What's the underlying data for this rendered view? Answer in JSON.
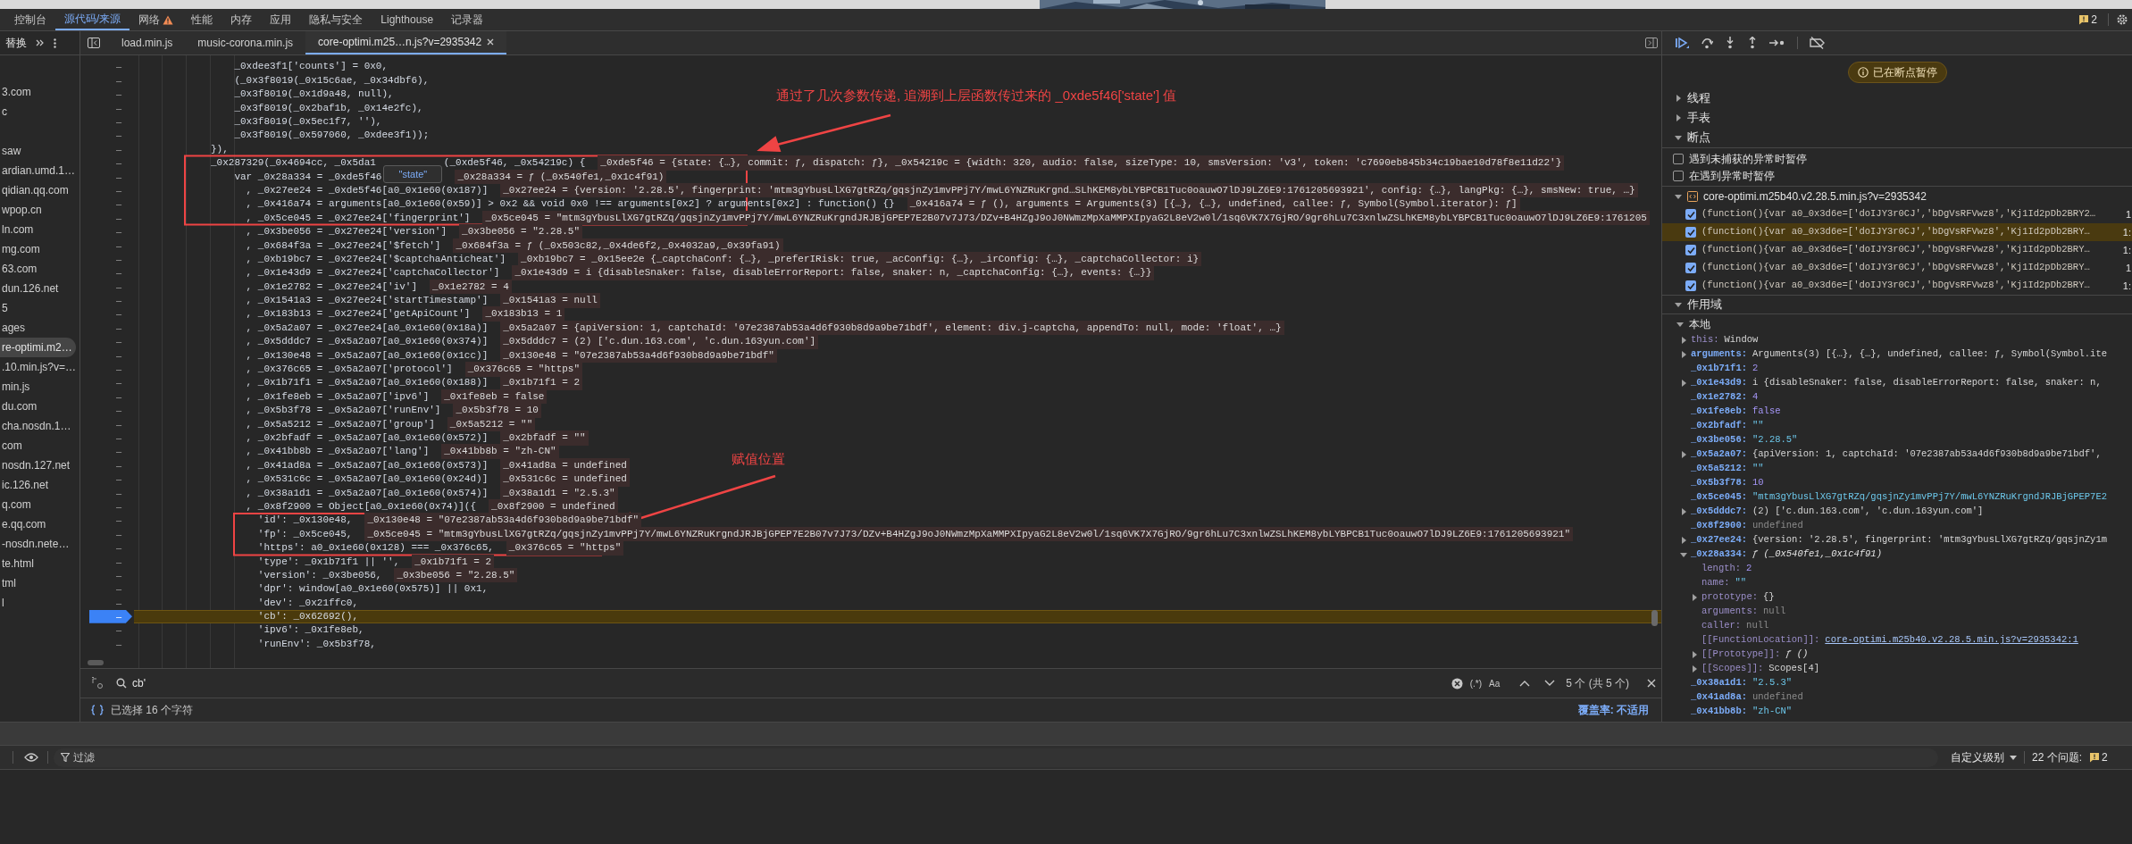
{
  "main_tabs": [
    {
      "label": "控制台",
      "selected": false,
      "warning": false
    },
    {
      "label": "源代码/来源",
      "selected": true,
      "warning": false
    },
    {
      "label": "网络",
      "selected": false,
      "warning": true
    },
    {
      "label": "性能",
      "selected": false,
      "warning": false
    },
    {
      "label": "内存",
      "selected": false,
      "warning": false
    },
    {
      "label": "应用",
      "selected": false,
      "warning": false
    },
    {
      "label": "隐私与安全",
      "selected": false,
      "warning": false
    },
    {
      "label": "Lighthouse",
      "selected": false,
      "warning": false
    },
    {
      "label": "记录器",
      "selected": false,
      "warning": false
    }
  ],
  "issue_badge": "2",
  "sidebar": {
    "title": "替换",
    "groups": [
      [
        {
          "label": "3.com",
          "selected": false
        },
        {
          "label": "c",
          "selected": false
        }
      ],
      [
        {
          "label": "saw",
          "selected": false
        },
        {
          "label": "ardian.umd.1…",
          "selected": false
        },
        {
          "label": "qidian.qq.com",
          "selected": false
        },
        {
          "label": "wpop.cn",
          "selected": false
        },
        {
          "label": "ln.com",
          "selected": false
        },
        {
          "label": "mg.com",
          "selected": false
        },
        {
          "label": "63.com",
          "selected": false
        },
        {
          "label": "dun.126.net",
          "selected": false
        },
        {
          "label": "5",
          "selected": false
        },
        {
          "label": "ages",
          "selected": false
        },
        {
          "label": "re-optimi.m2…",
          "selected": true
        },
        {
          "label": ".10.min.js?v=…",
          "selected": false
        },
        {
          "label": "min.js",
          "selected": false
        },
        {
          "label": "du.com",
          "selected": false
        },
        {
          "label": "cha.nosdn.1…",
          "selected": false
        },
        {
          "label": "com",
          "selected": false
        },
        {
          "label": "nosdn.127.net",
          "selected": false
        },
        {
          "label": "ic.126.net",
          "selected": false
        },
        {
          "label": "q.com",
          "selected": false
        },
        {
          "label": "e.qq.com",
          "selected": false
        },
        {
          "label": "-nosdn.nete…",
          "selected": false
        },
        {
          "label": "te.html",
          "selected": false
        },
        {
          "label": "tml",
          "selected": false
        },
        {
          "label": "l",
          "selected": false
        }
      ]
    ]
  },
  "file_tabs": [
    {
      "label": "load.min.js",
      "selected": false
    },
    {
      "label": "music-corona.min.js",
      "selected": false
    },
    {
      "label": "core-optimi.m25…n.js?v=2935342",
      "selected": true
    }
  ],
  "code_lines": [
    {
      "gutter": "–",
      "code": "    _0xdee3f1['counts'] = 0x0,",
      "paused": false
    },
    {
      "gutter": "–",
      "code": "    (_0x3f8019(_0x15c6ae, _0x34dbf6),",
      "paused": false
    },
    {
      "gutter": "–",
      "code": "    _0x3f8019(_0x1d9a48, null),",
      "paused": false
    },
    {
      "gutter": "–",
      "code": "    _0x3f8019(_0x2baf1b, _0x14e2fc),",
      "paused": false
    },
    {
      "gutter": "–",
      "code": "    _0x3f8019(_0x5ec1f7, ''),",
      "paused": false
    },
    {
      "gutter": "–",
      "code": "    _0x3f8019(_0x597060, _0xdee3f1));",
      "paused": false
    },
    {
      "gutter": "–",
      "code": "}),",
      "paused": false
    },
    {
      "gutter": "–",
      "code": "_0x287329(_0x4694cc, _0x5da1",
      "code_after": "(_0xde5f46, _0x54219c) {",
      "value": "_0xde5f46 = {state: {…}, commit: ƒ, dispatch: ƒ}, _0x54219c = {width: 320, audio: false, sizeType: 10, smsVersion: 'v3', token: 'c7690eb845b34c19bae10d78f8e11d22'}",
      "paused": false
    },
    {
      "gutter": "–",
      "code": "    var _0x28a334 = _0xde5f46",
      "tooltip": "\"state\"",
      "value": "_0x28a334 = ƒ (_0x540fe1,_0x1c4f91)",
      "paused": false
    },
    {
      "gutter": "–",
      "code": "      , _0x27ee24 = _0xde5f46[a0_0x1e60(0x187)]",
      "value": "_0x27ee24 = {version: '2.28.5', fingerprint: 'mtm3gYbusLlXG7gtRZq/gqsjnZy1mvPPj7Y/mwL6YNZRuKrgnd…SLhKEM8ybLYBPCB1Tuc0oauwO7lDJ9LZ6E9:1761205693921', config: {…}, langPkg: {…}, smsNew: true, …}",
      "paused": false
    },
    {
      "gutter": "–",
      "code": "      , _0x416a74 = arguments[a0_0x1e60(0x59)] > 0x2 && void 0x0 !== arguments[0x2] ? arguments[0x2] : function() {}",
      "value": "_0x416a74 = ƒ (), arguments = Arguments(3) [{…}, {…}, undefined, callee: ƒ, Symbol(Symbol.iterator): ƒ]",
      "paused": false
    },
    {
      "gutter": "–",
      "code": "      , _0x5ce045 = _0x27ee24['fingerprint']",
      "value": "_0x5ce045 = \"mtm3gYbusLlXG7gtRZq/gqsjnZy1mvPPj7Y/mwL6YNZRuKrgndJRJBjGPEP7E2B07v7J73/DZv+B4HZgJ9oJ0NWmzMpXaMMPXIpyaG2L8eV2w0l/1sq6VK7X7GjRO/9gr6hLu7C3xnlwZSLhKEM8ybLYBPCB1Tuc0oauwO7lDJ9LZ6E9:1761205",
      "paused": false
    },
    {
      "gutter": "–",
      "code": "      , _0x3be056 = _0x27ee24['version']",
      "value": "_0x3be056 = \"2.28.5\"",
      "paused": false
    },
    {
      "gutter": "–",
      "code": "      , _0x684f3a = _0x27ee24['$fetch']",
      "value": "_0x684f3a = ƒ (_0x503c82,_0x4de6f2,_0x4032a9,_0x39fa91)",
      "paused": false
    },
    {
      "gutter": "–",
      "code": "      , _0xb19bc7 = _0x27ee24['$captchaAnticheat']",
      "value": "_0xb19bc7 = _0x15ee2e {_captchaConf: {…}, _preferIRisk: true, _acConfig: {…}, _irConfig: {…}, _captchaCollector: i}",
      "paused": false
    },
    {
      "gutter": "–",
      "code": "      , _0x1e43d9 = _0x27ee24['captchaCollector']",
      "value": "_0x1e43d9 = i {disableSnaker: false, disableErrorReport: false, snaker: n, _captchaConfig: {…}, events: {…}}",
      "paused": false
    },
    {
      "gutter": "–",
      "code": "      , _0x1e2782 = _0x27ee24['iv']",
      "value": "_0x1e2782 = 4",
      "paused": false
    },
    {
      "gutter": "–",
      "code": "      , _0x1541a3 = _0x27ee24['startTimestamp']",
      "value": "_0x1541a3 = null",
      "paused": false
    },
    {
      "gutter": "–",
      "code": "      , _0x183b13 = _0x27ee24['getApiCount']",
      "value": "_0x183b13 = 1",
      "paused": false
    },
    {
      "gutter": "–",
      "code": "      , _0x5a2a07 = _0x27ee24[a0_0x1e60(0x18a)]",
      "value": "_0x5a2a07 = {apiVersion: 1, captchaId: '07e2387ab53a4d6f930b8d9a9be71bdf', element: div.j-captcha, appendTo: null, mode: 'float', …}",
      "paused": false
    },
    {
      "gutter": "–",
      "code": "      , _0x5dddc7 = _0x5a2a07[a0_0x1e60(0x374)]",
      "value": "_0x5dddc7 = (2) ['c.dun.163.com', 'c.dun.163yun.com']",
      "paused": false
    },
    {
      "gutter": "–",
      "code": "      , _0x130e48 = _0x5a2a07[a0_0x1e60(0x1cc)]",
      "value": "_0x130e48 = \"07e2387ab53a4d6f930b8d9a9be71bdf\"",
      "paused": false
    },
    {
      "gutter": "–",
      "code": "      , _0x376c65 = _0x5a2a07['protocol']",
      "value": "_0x376c65 = \"https\"",
      "paused": false
    },
    {
      "gutter": "–",
      "code": "      , _0x1b71f1 = _0x5a2a07[a0_0x1e60(0x188)]",
      "value": "_0x1b71f1 = 2",
      "paused": false
    },
    {
      "gutter": "–",
      "code": "      , _0x1fe8eb = _0x5a2a07['ipv6']",
      "value": "_0x1fe8eb = false",
      "paused": false
    },
    {
      "gutter": "–",
      "code": "      , _0x5b3f78 = _0x5a2a07['runEnv']",
      "value": "_0x5b3f78 = 10",
      "paused": false
    },
    {
      "gutter": "–",
      "code": "      , _0x5a5212 = _0x5a2a07['group']",
      "value": "_0x5a5212 = \"\"",
      "paused": false
    },
    {
      "gutter": "–",
      "code": "      , _0x2bfadf = _0x5a2a07[a0_0x1e60(0x572)]",
      "value": "_0x2bfadf = \"\"",
      "paused": false
    },
    {
      "gutter": "–",
      "code": "      , _0x41bb8b = _0x5a2a07['lang']",
      "value": "_0x41bb8b = \"zh-CN\"",
      "paused": false
    },
    {
      "gutter": "–",
      "code": "      , _0x41ad8a = _0x5a2a07[a0_0x1e60(0x573)]",
      "value": "_0x41ad8a = undefined",
      "paused": false
    },
    {
      "gutter": "–",
      "code": "      , _0x531c6c = _0x5a2a07[a0_0x1e60(0x24d)]",
      "value": "_0x531c6c = undefined",
      "paused": false
    },
    {
      "gutter": "–",
      "code": "      , _0x38a1d1 = _0x5a2a07[a0_0x1e60(0x574)]",
      "value": "_0x38a1d1 = \"2.5.3\"",
      "paused": false
    },
    {
      "gutter": "–",
      "code": "      , _0x8f2900 = Object[a0_0x1e60(0x74)]({",
      "value": "_0x8f2900 = undefined",
      "paused": false
    },
    {
      "gutter": "–",
      "code": "        'id': _0x130e48,",
      "value": "_0x130e48 = \"07e2387ab53a4d6f930b8d9a9be71bdf\"",
      "paused": false
    },
    {
      "gutter": "–",
      "code": "        'fp': _0x5ce045,",
      "value": "_0x5ce045 = \"mtm3gYbusLlXG7gtRZq/gqsjnZy1mvPPj7Y/mwL6YNZRuKrgndJRJBjGPEP7E2B07v7J73/DZv+B4HZgJ9oJ0NWmzMpXaMMPXIpyaG2L8eV2w0l/1sq6VK7X7GjRO/9gr6hLu7C3xnlwZSLhKEM8ybLYBPCB1Tuc0oauwO7lDJ9LZ6E9:1761205693921\"",
      "paused": false
    },
    {
      "gutter": "–",
      "code": "        'https': a0_0x1e60(0x128) === _0x376c65,",
      "value": "_0x376c65 = \"https\"",
      "paused": false
    },
    {
      "gutter": "–",
      "code": "        'type': _0x1b71f1 || '',",
      "value": "_0x1b71f1 = 2",
      "paused": false
    },
    {
      "gutter": "–",
      "code": "        'version': _0x3be056,",
      "value": "_0x3be056 = \"2.28.5\"",
      "paused": false
    },
    {
      "gutter": "–",
      "code": "        'dpr': window[a0_0x1e60(0x575)] || 0x1,",
      "paused": false
    },
    {
      "gutter": "–",
      "code": "        'dev': _0x21ffc0,",
      "paused": false
    },
    {
      "gutter": "–",
      "code": "        'cb': _0x62692(),",
      "paused": true
    },
    {
      "gutter": "–",
      "code": "        'ipv6': _0x1fe8eb,",
      "paused": false
    },
    {
      "gutter": "–",
      "code": "        'runEnv': _0x5b3f78,",
      "paused": false
    }
  ],
  "annotations": [
    {
      "text": "通过了几次参数传递, 追溯到上层函数传过来的 _0xde5f46['state'] 值",
      "kind": "note"
    },
    {
      "text": "赋值位置",
      "kind": "label"
    }
  ],
  "search": {
    "value": "cb'",
    "regex": "(.*)",
    "match_case": "Aa",
    "match_count": "5 个 (共 5 个)"
  },
  "status": {
    "selection": "已选择 16 个字符",
    "coverage": "覆盖率: 不适用"
  },
  "debugger": {
    "paused_message": "已在断点暂停",
    "panes": [
      {
        "title": "线程",
        "expanded": false
      },
      {
        "title": "手表",
        "expanded": false
      },
      {
        "title": "断点",
        "expanded": true
      }
    ],
    "exception_options": [
      {
        "label": "遇到未捕获的异常时暂停",
        "checked": false
      },
      {
        "label": "在遇到异常时暂停",
        "checked": false
      }
    ],
    "breakpoint_file": {
      "name": "core-optimi.m25b40.v2.28.5.min.js?v=2935342",
      "expanded": true
    },
    "breakpoints": [
      {
        "code": "(function(){var a0_0x3d6e=['doIJY3r0CJ','bDgVsRFVwz8','Kj1Id2pDb2BRY2…",
        "line": "1",
        "checked": true,
        "selected": false
      },
      {
        "code": "(function(){var a0_0x3d6e=['doIJY3r0CJ','bDgVsRFVwz8','Kj1Id2pDb2BRY…",
        "line": "1:",
        "checked": true,
        "selected": true
      },
      {
        "code": "(function(){var a0_0x3d6e=['doIJY3r0CJ','bDgVsRFVwz8','Kj1Id2pDb2BRY…",
        "line": "1:",
        "checked": true,
        "selected": false
      },
      {
        "code": "(function(){var a0_0x3d6e=['doIJY3r0CJ','bDgVsRFVwz8','Kj1Id2pDb2BRY…",
        "line": "1",
        "checked": true,
        "selected": false
      },
      {
        "code": "(function(){var a0_0x3d6e=['doIJY3r0CJ','bDgVsRFVwz8','Kj1Id2pDb2BRY…",
        "line": "1:",
        "checked": true,
        "selected": false
      }
    ],
    "scope": {
      "title": "作用域",
      "expanded": true,
      "local": {
        "title": "本地",
        "expanded": true,
        "variables": [
          {
            "key": "this:",
            "value": "Window",
            "kind": "object",
            "expanded": false,
            "dim": true
          },
          {
            "key": "arguments:",
            "value": "Arguments(3) [{…}, {…}, undefined, callee: ƒ, Symbol(Symbol.ite",
            "kind": "object",
            "expanded": false,
            "dim": false
          },
          {
            "key": "_0x1b71f1:",
            "value": "2",
            "kind": "number",
            "dim": false
          },
          {
            "key": "_0x1e43d9:",
            "value": "i {disableSnaker: false, disableErrorReport: false, snaker: n,",
            "kind": "object",
            "expanded": false,
            "dim": false
          },
          {
            "key": "_0x1e2782:",
            "value": "4",
            "kind": "number",
            "dim": false
          },
          {
            "key": "_0x1fe8eb:",
            "value": "false",
            "kind": "number",
            "dim": false
          },
          {
            "key": "_0x2bfadf:",
            "value": "\"\"",
            "kind": "string",
            "dim": false
          },
          {
            "key": "_0x3be056:",
            "value": "\"2.28.5\"",
            "kind": "string",
            "dim": false
          },
          {
            "key": "_0x5a2a07:",
            "value": "{apiVersion: 1, captchaId: '07e2387ab53a4d6f930b8d9a9be71bdf',",
            "kind": "object",
            "expanded": false,
            "dim": false
          },
          {
            "key": "_0x5a5212:",
            "value": "\"\"",
            "kind": "string",
            "dim": false
          },
          {
            "key": "_0x5b3f78:",
            "value": "10",
            "kind": "number",
            "dim": false
          },
          {
            "key": "_0x5ce045:",
            "value": "\"mtm3gYbusLlXG7gtRZq/gqsjnZy1mvPPj7Y/mwL6YNZRuKrgndJRJBjGPEP7E2",
            "kind": "string",
            "dim": false
          },
          {
            "key": "_0x5dddc7:",
            "value": "(2) ['c.dun.163.com', 'c.dun.163yun.com']",
            "kind": "object",
            "expanded": false,
            "dim": false
          },
          {
            "key": "_0x8f2900:",
            "value": "undefined",
            "kind": "empty",
            "dim": false
          },
          {
            "key": "_0x27ee24:",
            "value": "{version: '2.28.5', fingerprint: 'mtm3gYbusLlXG7gtRZq/gqsjnZy1m",
            "kind": "object",
            "expanded": false,
            "dim": false
          },
          {
            "key": "_0x28a334:",
            "value": "ƒ (_0x540fe1,_0x1c4f91)",
            "kind": "function",
            "expanded": true,
            "dim": false,
            "children": [
              {
                "key": "length:",
                "value": "2",
                "kind": "number",
                "dim": true
              },
              {
                "key": "name:",
                "value": "\"\"",
                "kind": "string",
                "dim": true
              },
              {
                "key": "prototype:",
                "value": "{}",
                "kind": "object",
                "expanded": false,
                "dim": true
              },
              {
                "key": "arguments:",
                "value": "null",
                "kind": "empty",
                "dim": true
              },
              {
                "key": "caller:",
                "value": "null",
                "kind": "empty",
                "dim": true
              },
              {
                "key": "[[FunctionLocation]]:",
                "value": "core-optimi.m25b40.v2.28.5.min.js?v=2935342:1",
                "kind": "link",
                "dim": true
              },
              {
                "key": "[[Prototype]]:",
                "value": "ƒ ()",
                "kind": "function",
                "expanded": false,
                "dim": true
              },
              {
                "key": "[[Scopes]]:",
                "value": "Scopes[4]",
                "kind": "object",
                "expanded": false,
                "dim": true
              }
            ]
          },
          {
            "key": "_0x38a1d1:",
            "value": "\"2.5.3\"",
            "kind": "string",
            "dim": false
          },
          {
            "key": "_0x41ad8a:",
            "value": "undefined",
            "kind": "empty",
            "dim": false
          },
          {
            "key": "_0x41bb8b:",
            "value": "\"zh-CN\"",
            "kind": "string",
            "dim": false
          }
        ]
      }
    }
  },
  "console": {
    "filter_placeholder": "过滤",
    "levels": "自定义级别",
    "issues": "22 个问题:",
    "issues_badge": "2"
  }
}
